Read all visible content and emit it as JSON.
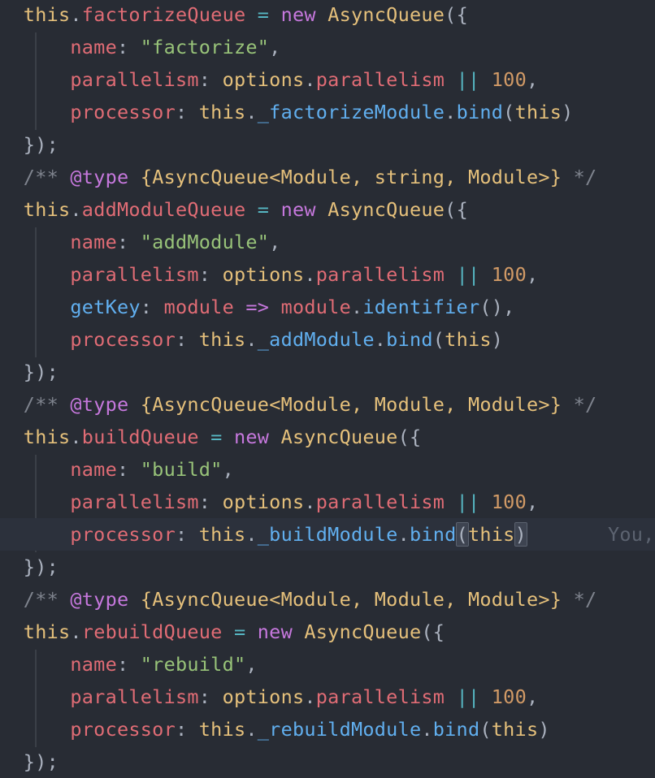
{
  "editor": {
    "blame_text": "You,",
    "queues": [
      {
        "comment": "",
        "var": "factorizeQueue",
        "name_value": "\"factorize\"",
        "processor_method": "_factorizeModule",
        "has_getkey": false
      },
      {
        "comment": "{AsyncQueue<Module, string, Module>}",
        "var": "addModuleQueue",
        "name_value": "\"addModule\"",
        "processor_method": "_addModule",
        "has_getkey": true
      },
      {
        "comment": "{AsyncQueue<Module, Module, Module>}",
        "var": "buildQueue",
        "name_value": "\"build\"",
        "processor_method": "_buildModule",
        "has_getkey": false
      },
      {
        "comment": "{AsyncQueue<Module, Module, Module>}",
        "var": "rebuildQueue",
        "name_value": "\"rebuild\"",
        "processor_method": "_rebuildModule",
        "has_getkey": false
      }
    ],
    "tokens": {
      "this": "this",
      "dot": ".",
      "assign": " = ",
      "new": "new",
      "class": "AsyncQueue",
      "open": "({",
      "close": "});",
      "name_key": "name",
      "colon": ": ",
      "comma": ",",
      "parallelism_key": "parallelism",
      "options": "options",
      "parallelism_prop": "parallelism",
      "or": "||",
      "hundred": "100",
      "getkey_key": "getKey",
      "module_param": "module",
      "arrow": "=>",
      "identifier": "identifier",
      "call_empty": "()",
      "processor_key": "processor",
      "bind": "bind",
      "paren_open": "(",
      "paren_close": ")",
      "comment_open": "/**",
      "type_tag": "@type",
      "comment_close": "*/"
    },
    "colors": {
      "background": "#282c34",
      "keyword": "#c678dd",
      "property": "#e06c75",
      "string": "#98c379",
      "number": "#d19a66",
      "function": "#61afef",
      "class": "#e5c07b",
      "operator": "#56b6c2",
      "comment": "#7f848e"
    }
  }
}
